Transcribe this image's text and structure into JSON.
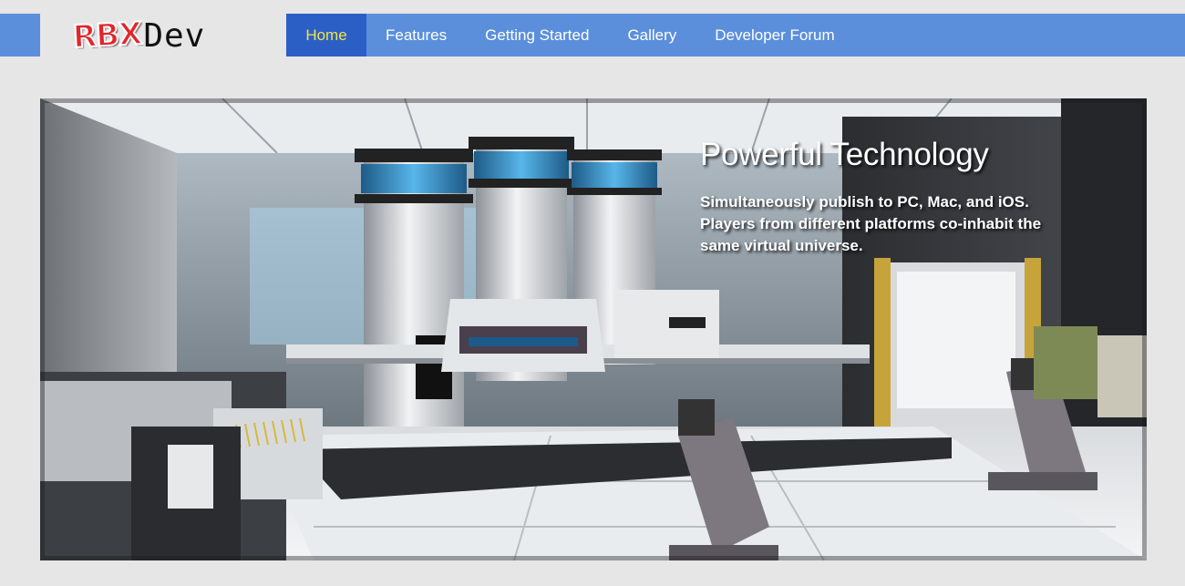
{
  "brand": {
    "logo_part1": "RBX",
    "logo_part2": "Dev"
  },
  "nav": {
    "items": [
      {
        "label": "Home",
        "active": true
      },
      {
        "label": "Features"
      },
      {
        "label": "Getting Started"
      },
      {
        "label": "Gallery"
      },
      {
        "label": "Developer Forum"
      }
    ]
  },
  "hero": {
    "title": "Powerful Technology",
    "description": "Simultaneously publish to PC, Mac, and iOS. Players from different platforms co-inhabit the same virtual universe."
  },
  "colors": {
    "nav_bg": "#5b8fdc",
    "nav_active_bg": "#2c5fc6",
    "nav_active_text": "#f2e34a",
    "page_bg": "#e6e6e6"
  }
}
